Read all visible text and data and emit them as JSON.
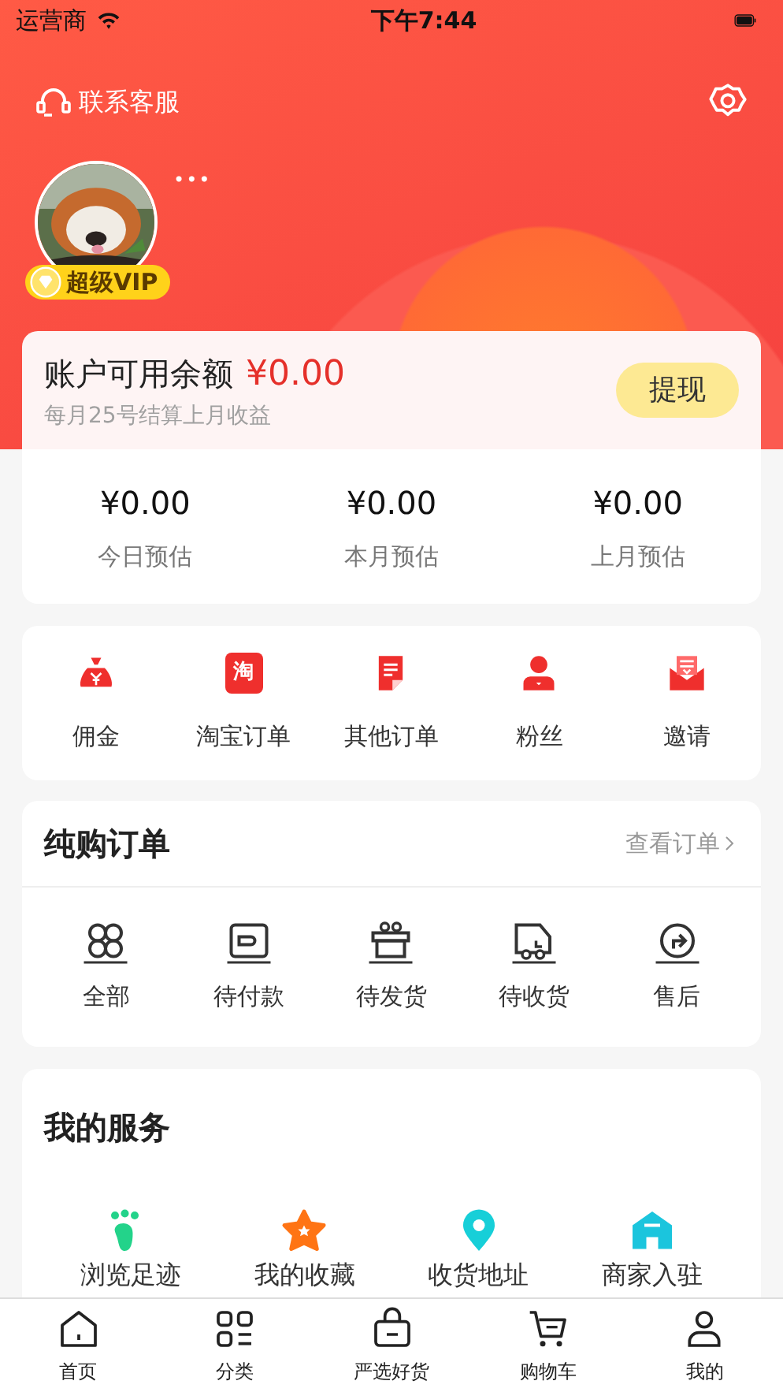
{
  "status_bar": {
    "carrier": "运营商",
    "time": "下午7:44"
  },
  "header": {
    "service_label": "联系客服",
    "more": "•••",
    "vip_badge": "超级VIP"
  },
  "balance": {
    "label": "账户可用余额",
    "amount": "¥0.00",
    "note": "每月25号结算上月收益",
    "withdraw_button": "提现"
  },
  "estimates": [
    {
      "value": "¥0.00",
      "label": "今日预估"
    },
    {
      "value": "¥0.00",
      "label": "本月预估"
    },
    {
      "value": "¥0.00",
      "label": "上月预估"
    }
  ],
  "shortcuts": [
    {
      "label": "佣金"
    },
    {
      "label": "淘宝订单",
      "icon_text": "淘"
    },
    {
      "label": "其他订单"
    },
    {
      "label": "粉丝"
    },
    {
      "label": "邀请"
    }
  ],
  "orders": {
    "title": "纯购订单",
    "view_all": "查看订单",
    "items": [
      {
        "label": "全部"
      },
      {
        "label": "待付款"
      },
      {
        "label": "待发货"
      },
      {
        "label": "待收货"
      },
      {
        "label": "售后"
      }
    ]
  },
  "services": {
    "title": "我的服务",
    "items": [
      {
        "label": "浏览足迹"
      },
      {
        "label": "我的收藏"
      },
      {
        "label": "收货地址"
      },
      {
        "label": "商家入驻"
      }
    ]
  },
  "tab_bar": [
    {
      "label": "首页"
    },
    {
      "label": "分类"
    },
    {
      "label": "严选好货"
    },
    {
      "label": "购物车"
    },
    {
      "label": "我的"
    }
  ]
}
